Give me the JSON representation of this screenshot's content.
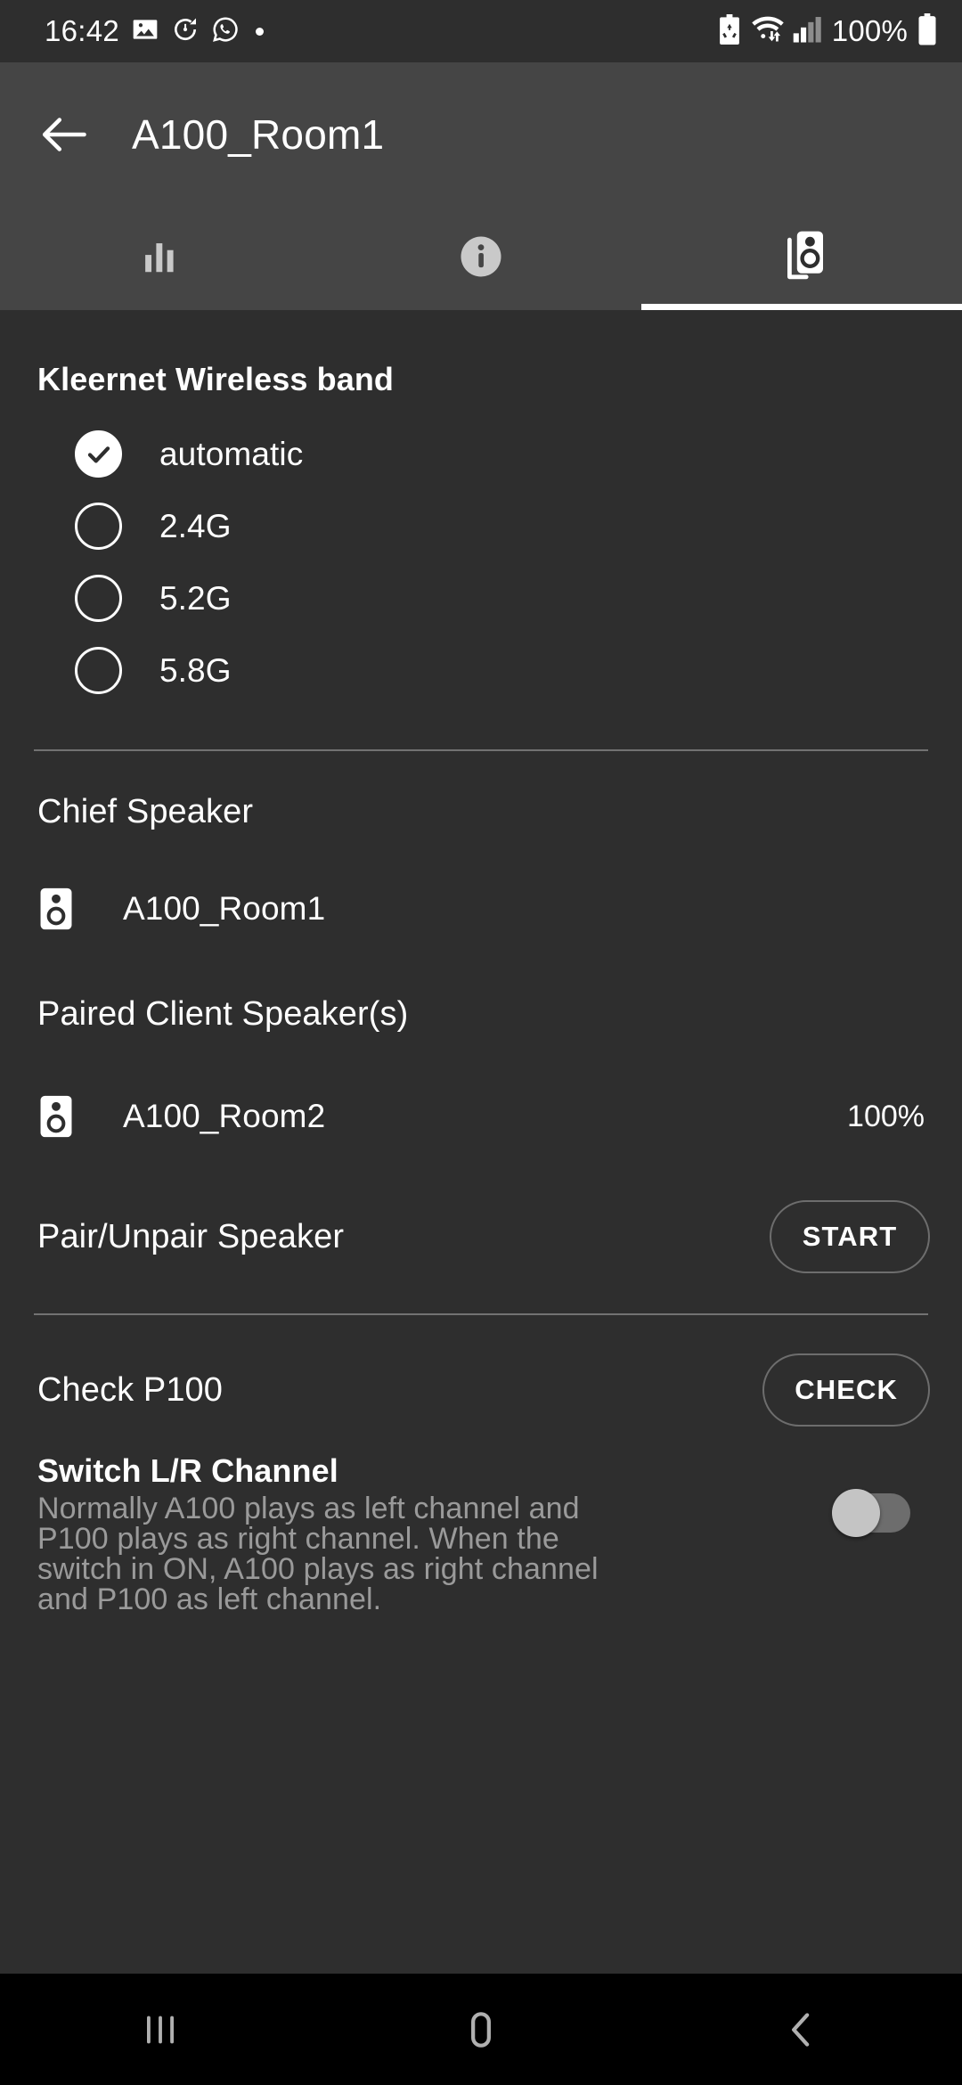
{
  "status_bar": {
    "time": "16:42",
    "left_icons": [
      "image-icon",
      "alarm-reset-icon",
      "whatsapp-icon"
    ],
    "right_icons": [
      "battery-saver-icon",
      "wifi-icon",
      "signal-icon"
    ],
    "battery_percent": "100%",
    "battery_icon": "battery-full-icon"
  },
  "app_bar": {
    "back_icon": "back-arrow-icon",
    "title": "A100_Room1"
  },
  "tabs": [
    {
      "name": "equalizer",
      "icon": "equalizer-icon",
      "active": false
    },
    {
      "name": "info",
      "icon": "info-circle-icon",
      "active": false
    },
    {
      "name": "speakers",
      "icon": "speaker-group-icon",
      "active": true
    }
  ],
  "wireless_band": {
    "title": "Kleernet Wireless band",
    "options": [
      {
        "label": "automatic",
        "selected": true
      },
      {
        "label": "2.4G",
        "selected": false
      },
      {
        "label": "5.2G",
        "selected": false
      },
      {
        "label": "5.8G",
        "selected": false
      }
    ]
  },
  "chief_speaker": {
    "title": "Chief Speaker",
    "icon": "speaker-icon",
    "name": "A100_Room1"
  },
  "paired_clients": {
    "title": "Paired Client Speaker(s)",
    "items": [
      {
        "icon": "speaker-icon",
        "name": "A100_Room2",
        "level": "100%"
      }
    ]
  },
  "pair_unpair": {
    "label": "Pair/Unpair Speaker",
    "button": "START"
  },
  "check_p100": {
    "label": "Check P100",
    "button": "CHECK"
  },
  "switch_lr": {
    "title": "Switch L/R Channel",
    "description": "Normally A100 plays as left channel and P100 plays as right channel. When the switch in ON, A100 plays as right channel and P100 as left channel.",
    "toggle_on": false
  },
  "nav_bar": {
    "recents": "recents-icon",
    "home": "home-icon",
    "back": "back-icon"
  },
  "colors": {
    "status_bg": "#2e2e2e",
    "appbar_bg": "#454545",
    "content_bg": "#2e2e2e",
    "accent": "#ffffff",
    "muted_text": "#9a9a9a",
    "navbar_bg": "#000000"
  }
}
